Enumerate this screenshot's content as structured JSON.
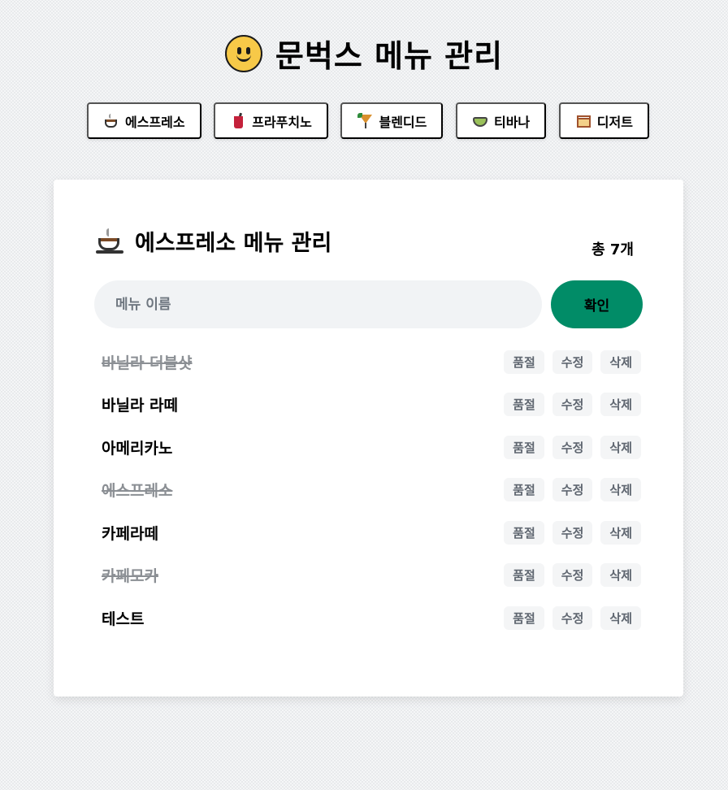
{
  "header": {
    "title": "문벅스 메뉴 관리",
    "icon": "smiley-icon"
  },
  "nav": [
    {
      "label": "에스프레소",
      "icon": "coffee-cup-icon"
    },
    {
      "label": "프라푸치노",
      "icon": "frappuccino-icon"
    },
    {
      "label": "블렌디드",
      "icon": "blended-drink-icon"
    },
    {
      "label": "티바나",
      "icon": "tea-icon"
    },
    {
      "label": "디저트",
      "icon": "cake-icon"
    }
  ],
  "section": {
    "title": "에스프레소 메뉴 관리",
    "count": "총 7개",
    "input_placeholder": "메뉴 이름",
    "confirm_label": "확인"
  },
  "actions": {
    "soldout": "품절",
    "edit": "수정",
    "delete": "삭제"
  },
  "menu_items": [
    {
      "name": "바닐라 더블샷",
      "sold_out": true
    },
    {
      "name": "바닐라 라떼",
      "sold_out": false
    },
    {
      "name": "아메리카노",
      "sold_out": false
    },
    {
      "name": "에스프레소",
      "sold_out": true
    },
    {
      "name": "카페라떼",
      "sold_out": false
    },
    {
      "name": "카페모카",
      "sold_out": true
    },
    {
      "name": "테스트",
      "sold_out": false
    }
  ],
  "colors": {
    "accent": "#018c67",
    "background": "#f5f6f7",
    "card": "#ffffff"
  }
}
